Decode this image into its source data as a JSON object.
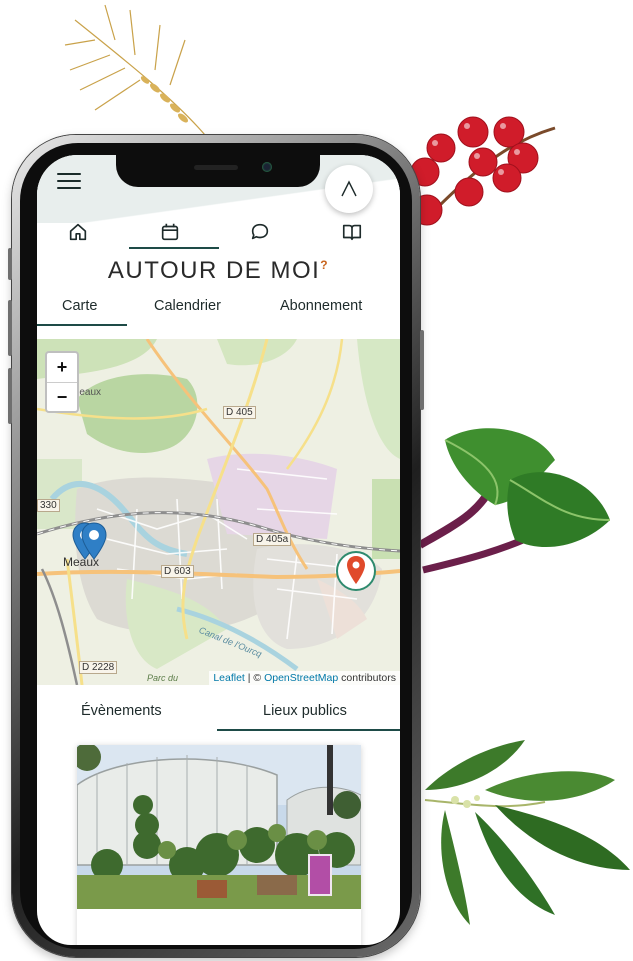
{
  "app": {
    "title": "AUTOUR DE MOI",
    "title_mark": "?"
  },
  "nav": {
    "icons": [
      "home-icon",
      "calendar-icon",
      "chat-icon",
      "book-icon"
    ],
    "active": 1
  },
  "tabs": [
    "Carte",
    "Calendrier",
    "Abonnement"
  ],
  "active_tab": 0,
  "map": {
    "zoom_in": "+",
    "zoom_out": "−",
    "road_labels": [
      "D 405",
      "D 405a",
      "D 603",
      "D 2228",
      "330"
    ],
    "place_labels": [
      "Meaux",
      "Meaux",
      "Canal de l'Ourcq",
      "Parc du"
    ],
    "attribution": {
      "leaflet": "Leaflet",
      "separator": " | © ",
      "osm": "OpenStreetMap",
      "suffix": " contributors"
    }
  },
  "sub_tabs": [
    "Évènements",
    "Lieux publics"
  ],
  "active_sub_tab": 1,
  "colors": {
    "accent": "#1e4b47",
    "title_mark": "#c8651e",
    "marker_blue": "#2f7fc6",
    "marker_red": "#e04a2b"
  }
}
